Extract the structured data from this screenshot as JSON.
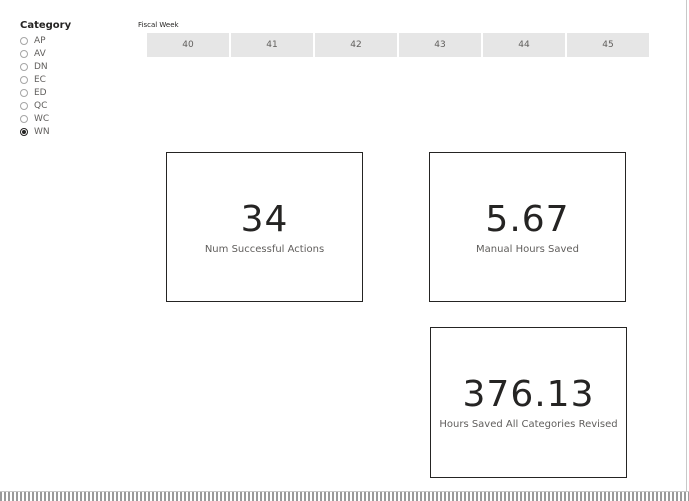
{
  "category_slicer": {
    "title": "Category",
    "options": [
      {
        "label": "AP",
        "selected": false
      },
      {
        "label": "AV",
        "selected": false
      },
      {
        "label": "DN",
        "selected": false
      },
      {
        "label": "EC",
        "selected": false
      },
      {
        "label": "ED",
        "selected": false
      },
      {
        "label": "QC",
        "selected": false
      },
      {
        "label": "WC",
        "selected": false
      },
      {
        "label": "WN",
        "selected": true
      }
    ]
  },
  "fiscal_week_slicer": {
    "title": "Fiscal Week",
    "weeks": [
      "40",
      "41",
      "42",
      "43",
      "44",
      "45"
    ]
  },
  "cards": [
    {
      "value": "34",
      "label": "Num Successful Actions"
    },
    {
      "value": "5.67",
      "label": "Manual Hours Saved"
    },
    {
      "value": "376.13",
      "label": "Hours Saved All Categories Revised"
    }
  ]
}
